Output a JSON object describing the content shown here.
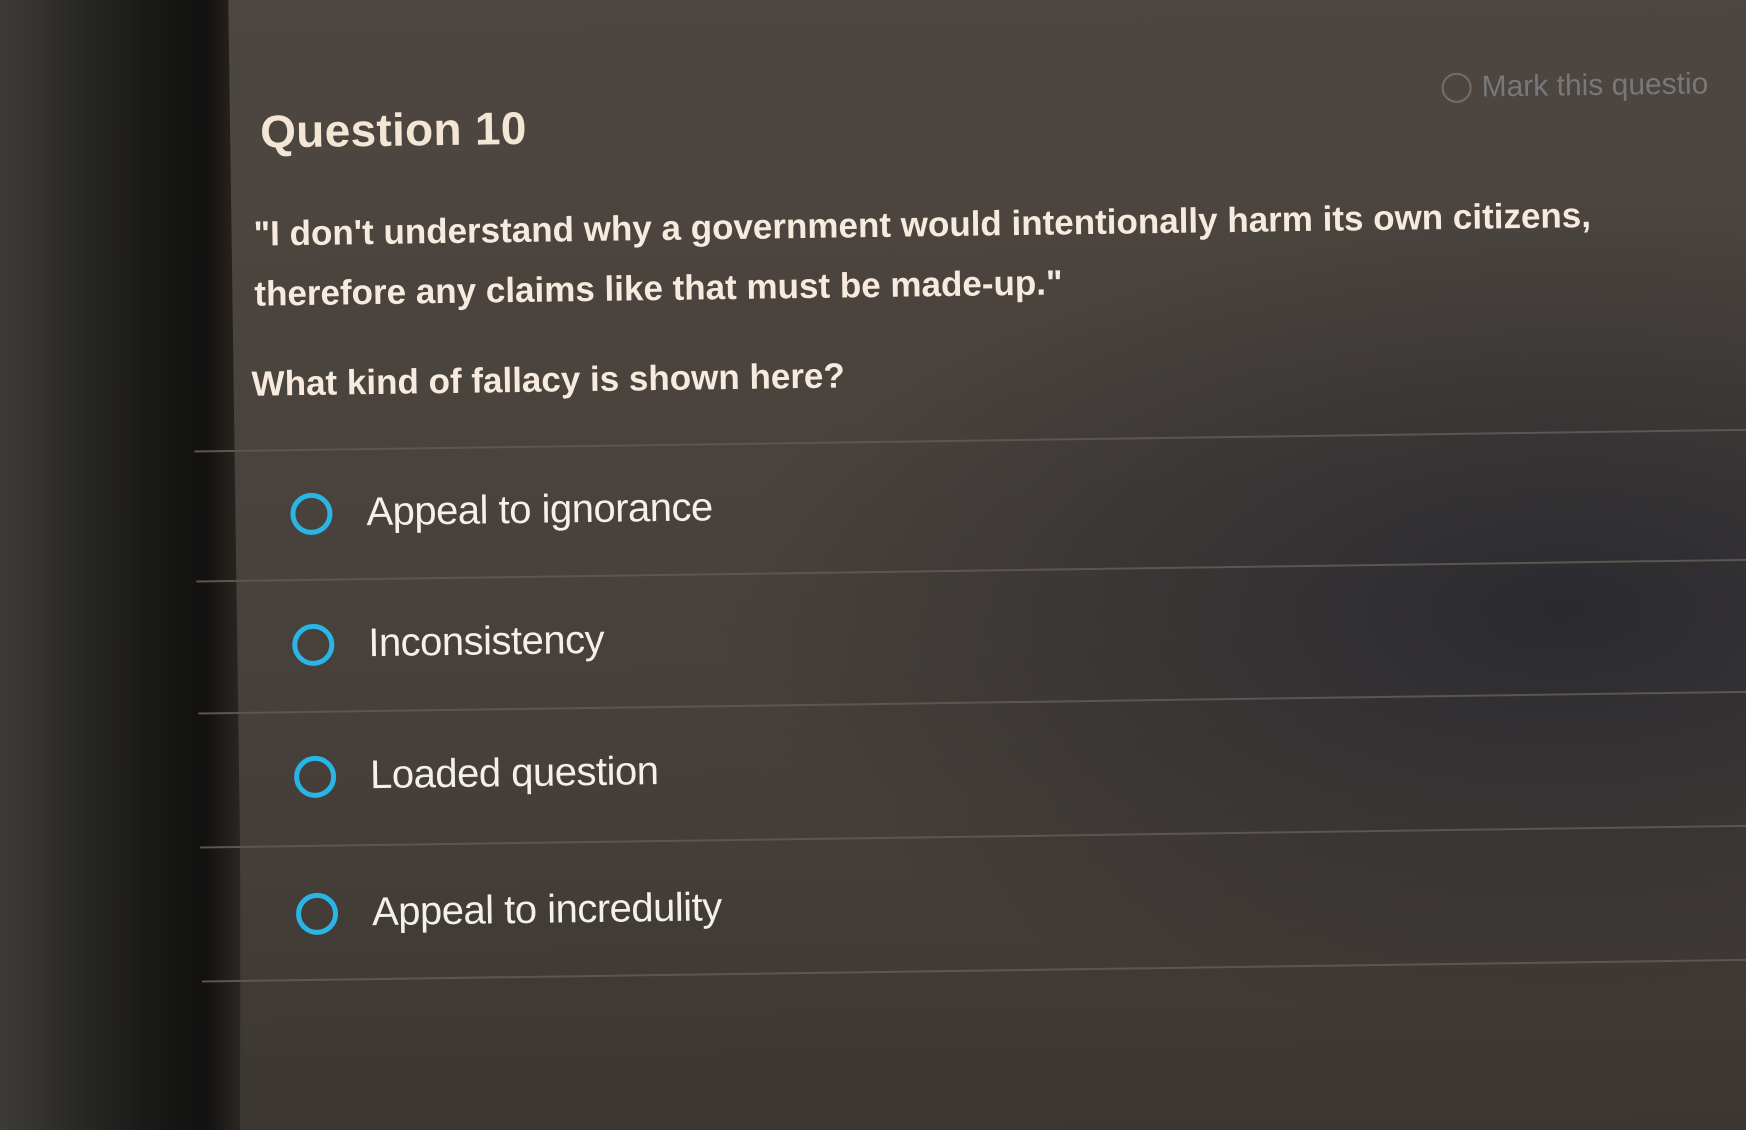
{
  "question": {
    "title": "Question 10",
    "mark_label": "Mark this questio",
    "quote": "\"I don't understand why a government would intentionally harm its own citizens, therefore any claims like that must be made-up.\"",
    "prompt": "What kind of fallacy is shown here?"
  },
  "options": [
    {
      "label": "Appeal to ignorance",
      "selected": false
    },
    {
      "label": "Inconsistency",
      "selected": false
    },
    {
      "label": "Loaded question",
      "selected": false
    },
    {
      "label": "Appeal to incredulity",
      "selected": false
    }
  ],
  "colors": {
    "radio_accent": "#29b6e6",
    "text": "#f6ebde",
    "background": "#4a433d"
  },
  "icons": {
    "radio": "radio-unchecked-icon",
    "mark": "circle-outline-icon"
  }
}
